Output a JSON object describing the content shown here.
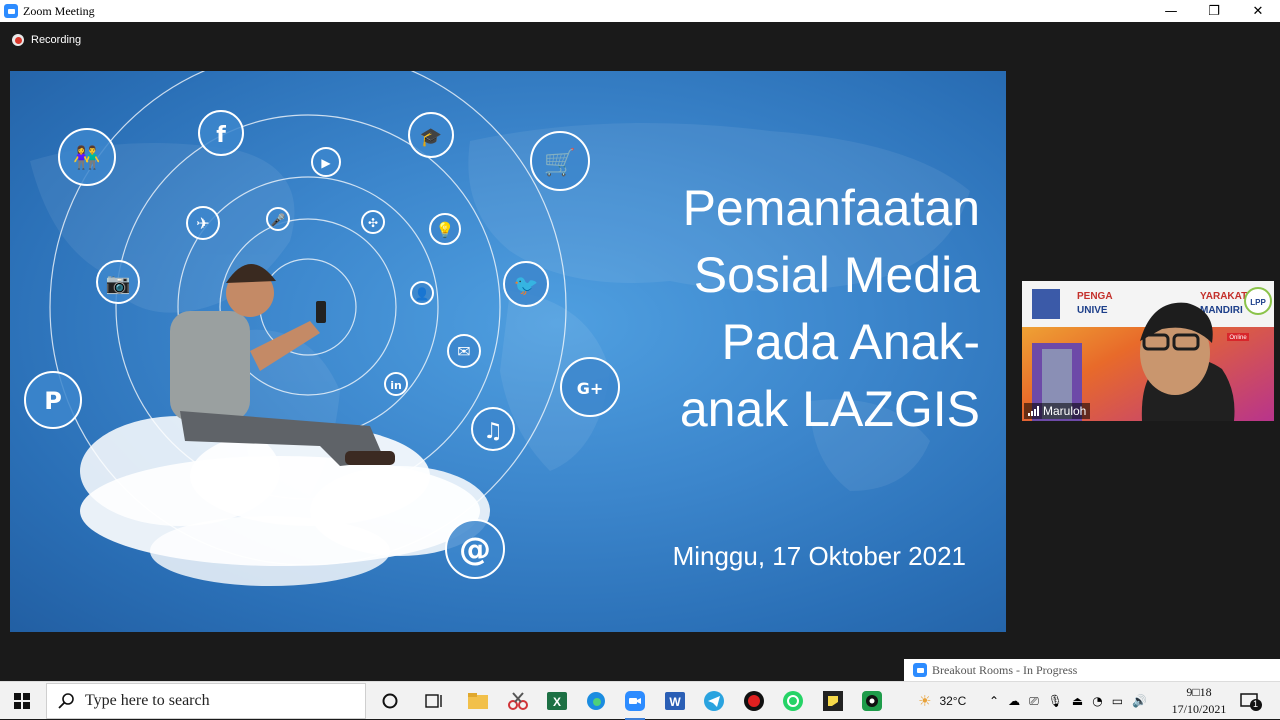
{
  "window": {
    "title": "Zoom Meeting",
    "minimize": "—",
    "restore": "❐",
    "close": "✕"
  },
  "meeting": {
    "recording_label": "Recording",
    "slide": {
      "title_lines": [
        "Pemanfaatan",
        "Sosial Media",
        "Pada Anak-",
        "anak LAZGIS"
      ],
      "date": "Minggu, 17 Oktober 2021"
    },
    "participant": {
      "name": "Maruloh",
      "banner_text": [
        "PENGA",
        "YARAKAT",
        "UNIVE",
        "MANDIRI",
        "LPP",
        "Online"
      ]
    },
    "breakout_banner": "Breakout Rooms - In Progress"
  },
  "taskbar": {
    "search_placeholder": "Type here to search",
    "weather": "32°C",
    "time": "9□18",
    "date": "17/10/2021",
    "notification_count": "1"
  },
  "colors": {
    "accent": "#2d8cff",
    "slide_blue": "#3c86cc",
    "recording_red": "#d9372b"
  }
}
